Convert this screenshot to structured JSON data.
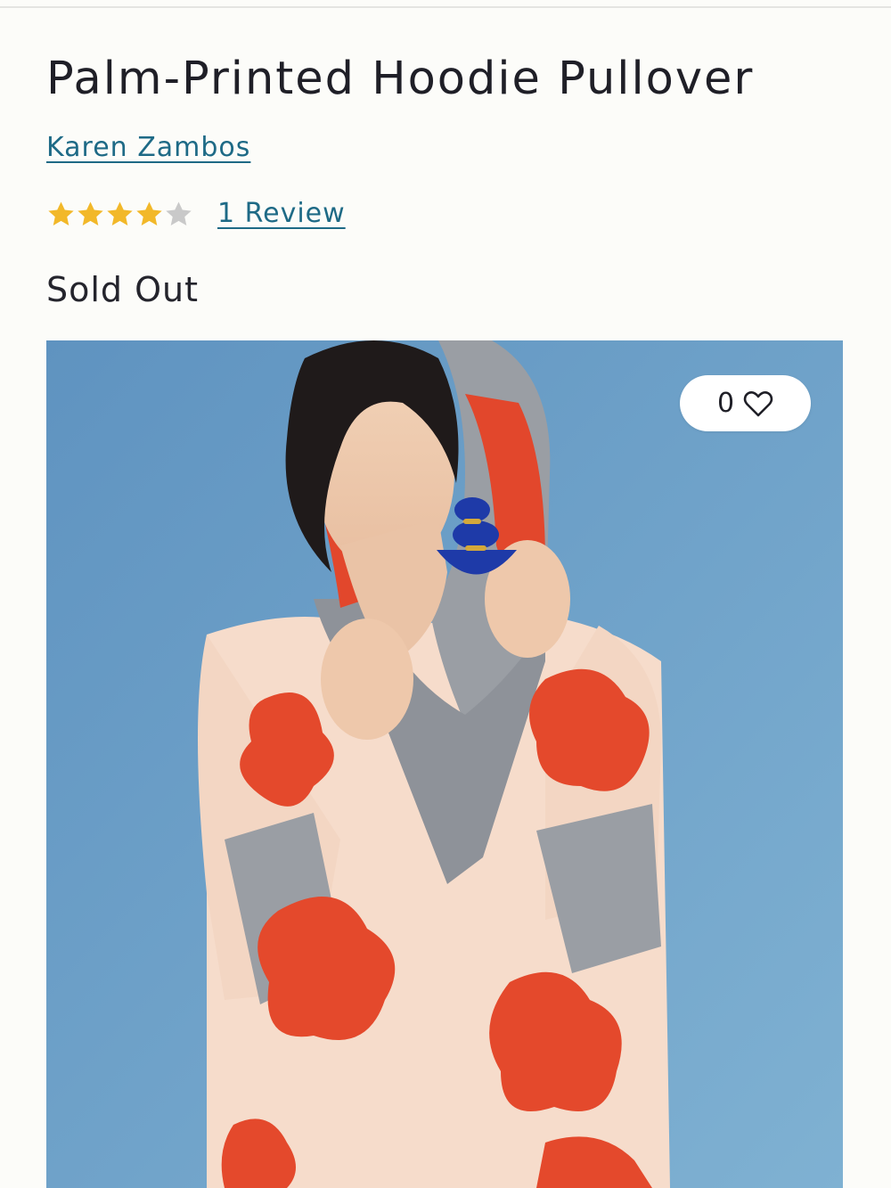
{
  "product": {
    "title": "Palm-Printed Hoodie Pullover",
    "brand": "Karen Zambos",
    "rating": 4,
    "rating_max": 5,
    "review_link": "1 Review",
    "stock_status": "Sold Out"
  },
  "favorite": {
    "count": "0",
    "icon": "heart-outline-icon"
  },
  "colors": {
    "link": "#1e6a86",
    "star_filled": "#f2b829",
    "star_empty": "#c9c9c9",
    "title": "#1f1f27"
  }
}
